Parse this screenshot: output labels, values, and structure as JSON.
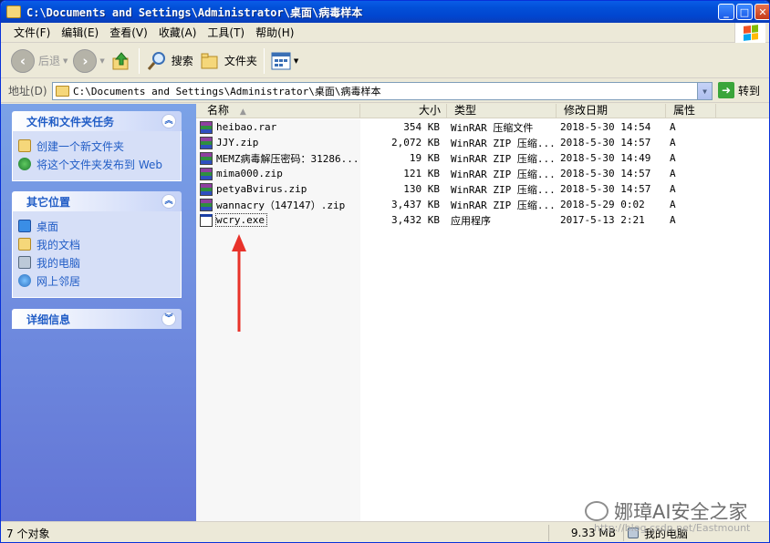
{
  "window": {
    "title": "C:\\Documents and Settings\\Administrator\\桌面\\病毒样本",
    "controls": {
      "minimize": "_",
      "maximize": "□",
      "close": "✕"
    }
  },
  "menu": [
    "文件(F)",
    "编辑(E)",
    "查看(V)",
    "收藏(A)",
    "工具(T)",
    "帮助(H)"
  ],
  "toolbar": {
    "back": "后退",
    "search": "搜索",
    "folders": "文件夹"
  },
  "address": {
    "label": "地址(D)",
    "value": "C:\\Documents and Settings\\Administrator\\桌面\\病毒样本",
    "go": "转到"
  },
  "sidebar": {
    "tasks": {
      "title": "文件和文件夹任务",
      "items": [
        "创建一个新文件夹",
        "将这个文件夹发布到 Web"
      ]
    },
    "places": {
      "title": "其它位置",
      "items": [
        "桌面",
        "我的文档",
        "我的电脑",
        "网上邻居"
      ]
    },
    "details": {
      "title": "详细信息"
    }
  },
  "columns": [
    "名称",
    "大小",
    "类型",
    "修改日期",
    "属性"
  ],
  "files": [
    {
      "name": "heibao.rar",
      "size": "354 KB",
      "type": "WinRAR 压缩文件",
      "date": "2018-5-30 14:54",
      "attr": "A",
      "icon": "winrar-icon"
    },
    {
      "name": "JJY.zip",
      "size": "2,072 KB",
      "type": "WinRAR ZIP 压缩...",
      "date": "2018-5-30 14:57",
      "attr": "A",
      "icon": "winrar-icon"
    },
    {
      "name": "MEMZ病毒解压密码：31286...",
      "size": "19 KB",
      "type": "WinRAR ZIP 压缩...",
      "date": "2018-5-30 14:49",
      "attr": "A",
      "icon": "winrar-icon"
    },
    {
      "name": "mima000.zip",
      "size": "121 KB",
      "type": "WinRAR ZIP 压缩...",
      "date": "2018-5-30 14:57",
      "attr": "A",
      "icon": "winrar-icon"
    },
    {
      "name": "petyaBvirus.zip",
      "size": "130 KB",
      "type": "WinRAR ZIP 压缩...",
      "date": "2018-5-30 14:57",
      "attr": "A",
      "icon": "winrar-icon"
    },
    {
      "name": "wannacry（147147）.zip",
      "size": "3,437 KB",
      "type": "WinRAR ZIP 压缩...",
      "date": "2018-5-29 0:02",
      "attr": "A",
      "icon": "winrar-icon"
    },
    {
      "name": "wcry.exe",
      "size": "3,432 KB",
      "type": "应用程序",
      "date": "2017-5-13 2:21",
      "attr": "A",
      "icon": "exe-icon"
    }
  ],
  "status": {
    "count": "7 个对象",
    "size": "9.33 MB",
    "location": "我的电脑"
  },
  "watermark": {
    "text": "娜璋AI安全之家",
    "url": "http://blog.csdn.net/Eastmount"
  },
  "colors": {
    "titlebar": "#0054e3",
    "taskpane": "#6375d6",
    "arrow": "#e8322a"
  }
}
